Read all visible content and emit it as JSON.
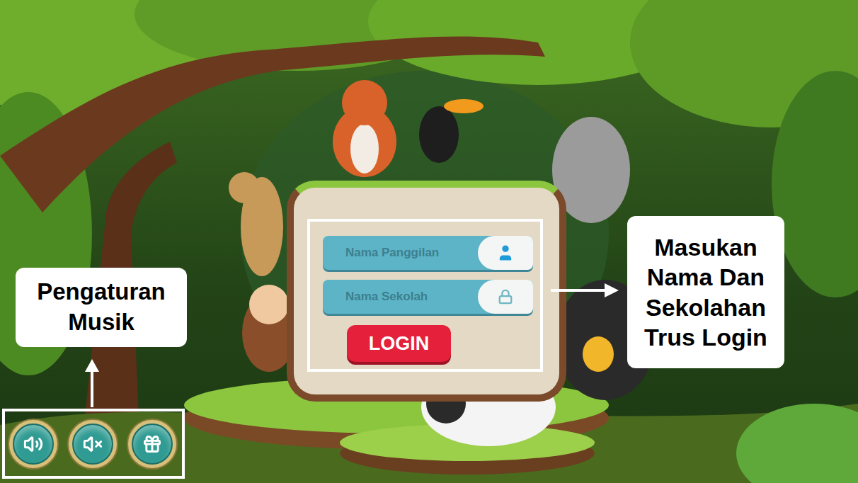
{
  "login": {
    "fields": [
      {
        "placeholder": "Nama Panggilan",
        "kind": "text"
      },
      {
        "placeholder": "Nama Sekolah",
        "kind": "password"
      }
    ],
    "button": "LOGIN"
  },
  "callouts": {
    "music": {
      "lines": [
        "Pengaturan",
        "Musik"
      ]
    },
    "login": {
      "lines": [
        "Masukan",
        "Nama Dan",
        "Sekolahan",
        "Trus Login"
      ]
    }
  }
}
